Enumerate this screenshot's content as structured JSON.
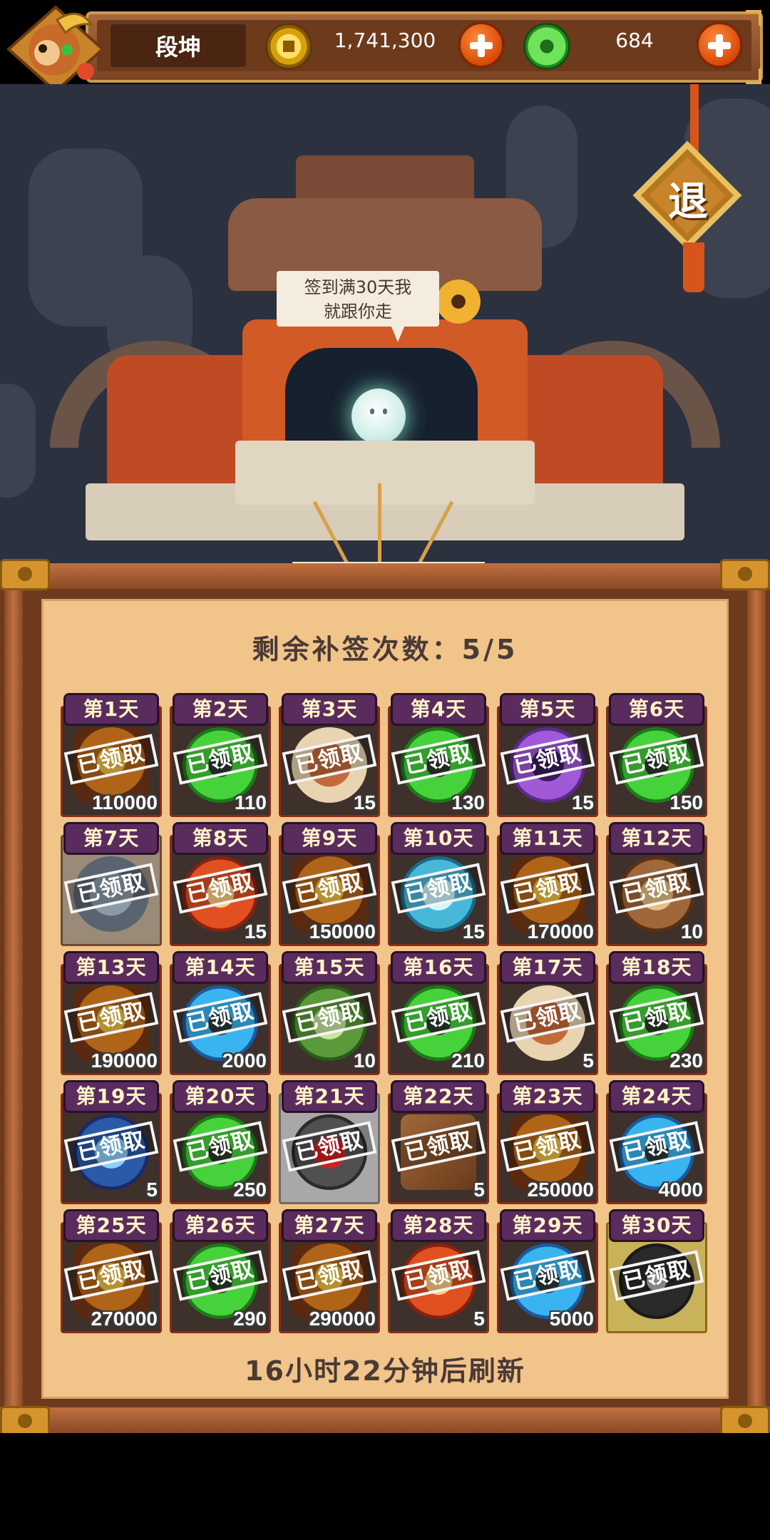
{
  "player": {
    "name": "段坤"
  },
  "currency": {
    "gold": {
      "amount": "1,741,300",
      "icon": "gold-coin-icon"
    },
    "jade": {
      "amount": "684",
      "icon": "jade-coin-icon"
    }
  },
  "exit_button": {
    "label": "退"
  },
  "speech_bubble": {
    "line1": "签到满30天我",
    "line2": "就跟你走"
  },
  "board": {
    "remaining_label": "剩余补签次数：",
    "remaining_value": "5/5",
    "refresh_text": "16小时22分钟后刷新",
    "claimed_label": "已领取",
    "days": [
      {
        "day": "第1天",
        "qty": "110000",
        "icon": "coins-icon",
        "style": "normal"
      },
      {
        "day": "第2天",
        "qty": "110",
        "icon": "jade-icon",
        "style": "normal"
      },
      {
        "day": "第3天",
        "qty": "15",
        "icon": "ring-icon",
        "style": "normal"
      },
      {
        "day": "第4天",
        "qty": "130",
        "icon": "jade-icon",
        "style": "normal"
      },
      {
        "day": "第5天",
        "qty": "15",
        "icon": "purple-gem-icon",
        "style": "normal"
      },
      {
        "day": "第6天",
        "qty": "150",
        "icon": "jade-icon",
        "style": "normal"
      },
      {
        "day": "第7天",
        "qty": "",
        "icon": "spirit-icon",
        "style": "tan"
      },
      {
        "day": "第8天",
        "qty": "15",
        "icon": "red-gem-icon",
        "style": "normal"
      },
      {
        "day": "第9天",
        "qty": "150000",
        "icon": "coins-icon",
        "style": "normal"
      },
      {
        "day": "第10天",
        "qty": "15",
        "icon": "crystal-icon",
        "style": "normal"
      },
      {
        "day": "第11天",
        "qty": "170000",
        "icon": "coins-icon",
        "style": "normal"
      },
      {
        "day": "第12天",
        "qty": "10",
        "icon": "bag-icon",
        "style": "normal"
      },
      {
        "day": "第13天",
        "qty": "190000",
        "icon": "coins-icon",
        "style": "normal"
      },
      {
        "day": "第14天",
        "qty": "2000",
        "icon": "blue-jade-icon",
        "style": "normal"
      },
      {
        "day": "第15天",
        "qty": "10",
        "icon": "green-gem-icon",
        "style": "normal"
      },
      {
        "day": "第16天",
        "qty": "210",
        "icon": "jade-icon",
        "style": "normal"
      },
      {
        "day": "第17天",
        "qty": "5",
        "icon": "ring-icon",
        "style": "normal"
      },
      {
        "day": "第18天",
        "qty": "230",
        "icon": "jade-icon",
        "style": "normal"
      },
      {
        "day": "第19天",
        "qty": "5",
        "icon": "blue-gem-icon",
        "style": "normal"
      },
      {
        "day": "第20天",
        "qty": "250",
        "icon": "jade-icon",
        "style": "normal"
      },
      {
        "day": "第21天",
        "qty": "",
        "icon": "sword-icon",
        "style": "gray"
      },
      {
        "day": "第22天",
        "qty": "5",
        "icon": "scroll-icon",
        "style": "normal"
      },
      {
        "day": "第23天",
        "qty": "250000",
        "icon": "coins-icon",
        "style": "normal"
      },
      {
        "day": "第24天",
        "qty": "4000",
        "icon": "blue-jade-icon",
        "style": "normal"
      },
      {
        "day": "第25天",
        "qty": "270000",
        "icon": "coins-icon",
        "style": "normal"
      },
      {
        "day": "第26天",
        "qty": "290",
        "icon": "jade-icon",
        "style": "normal"
      },
      {
        "day": "第27天",
        "qty": "290000",
        "icon": "coins-icon",
        "style": "normal"
      },
      {
        "day": "第28天",
        "qty": "5",
        "icon": "red-gem-icon",
        "style": "normal"
      },
      {
        "day": "第29天",
        "qty": "5000",
        "icon": "blue-jade-icon",
        "style": "normal"
      },
      {
        "day": "第30天",
        "qty": "",
        "icon": "dark-orb-icon",
        "style": "gold"
      }
    ]
  }
}
